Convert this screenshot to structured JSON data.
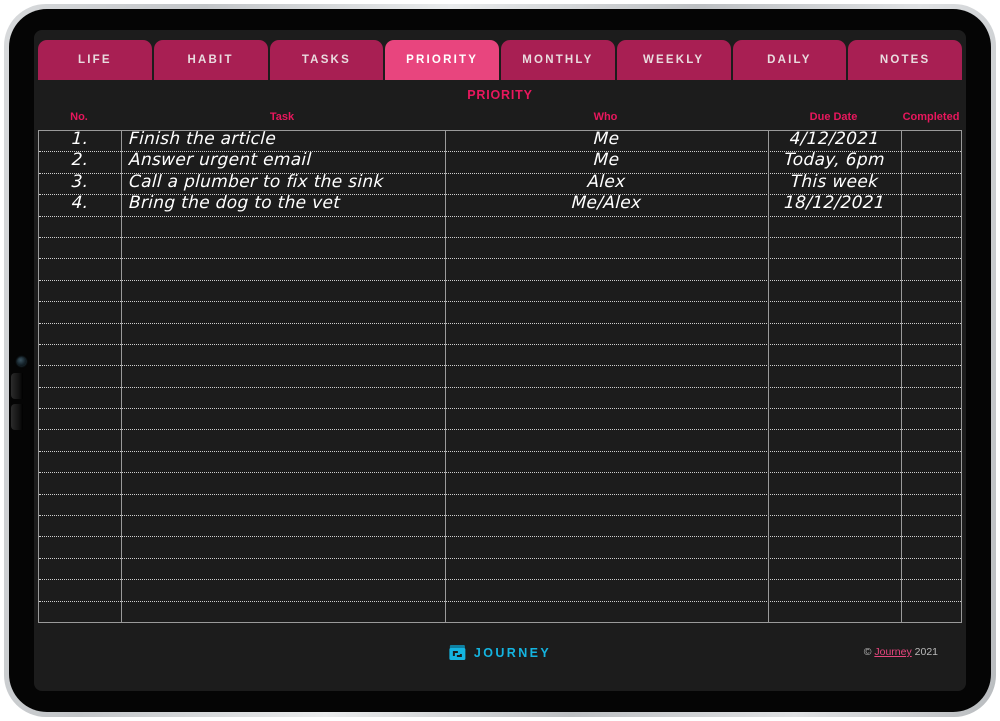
{
  "app": {
    "title": "Journey Priority Planner",
    "accent_pink": "#e8175d",
    "tab_active_color": "#e8457e",
    "tab_inactive_color": "#a81f53",
    "brand_color": "#14b4e0",
    "screen_bg": "#1c1c1c"
  },
  "tabs": [
    {
      "label": "LIFE",
      "active": false
    },
    {
      "label": "HABIT",
      "active": false
    },
    {
      "label": "TASKS",
      "active": false
    },
    {
      "label": "PRIORITY",
      "active": true
    },
    {
      "label": "MONTHLY",
      "active": false
    },
    {
      "label": "WEEKLY",
      "active": false
    },
    {
      "label": "DAILY",
      "active": false
    },
    {
      "label": "NOTES",
      "active": false
    }
  ],
  "page": {
    "title": "PRIORITY"
  },
  "table": {
    "headers": {
      "no": "No.",
      "task": "Task",
      "who": "Who",
      "due_date": "Due Date",
      "completed": "Completed"
    },
    "total_rows": 23,
    "rows": [
      {
        "no": "1.",
        "task": "Finish the article",
        "who": "Me",
        "due": "4/12/2021",
        "completed": ""
      },
      {
        "no": "2.",
        "task": "Answer urgent email",
        "who": "Me",
        "due": "Today, 6pm",
        "completed": ""
      },
      {
        "no": "3.",
        "task": "Call a plumber to fix the sink",
        "who": "Alex",
        "due": "This week",
        "completed": ""
      },
      {
        "no": "4.",
        "task": "Bring the dog to the vet",
        "who": "Me/Alex",
        "due": "18/12/2021",
        "completed": ""
      }
    ]
  },
  "footer": {
    "brand_name": "JOURNEY",
    "brand_icon": "journey-bag-icon",
    "copyright_symbol": "©",
    "copyright_link": "Journey",
    "copyright_year": "2021"
  }
}
